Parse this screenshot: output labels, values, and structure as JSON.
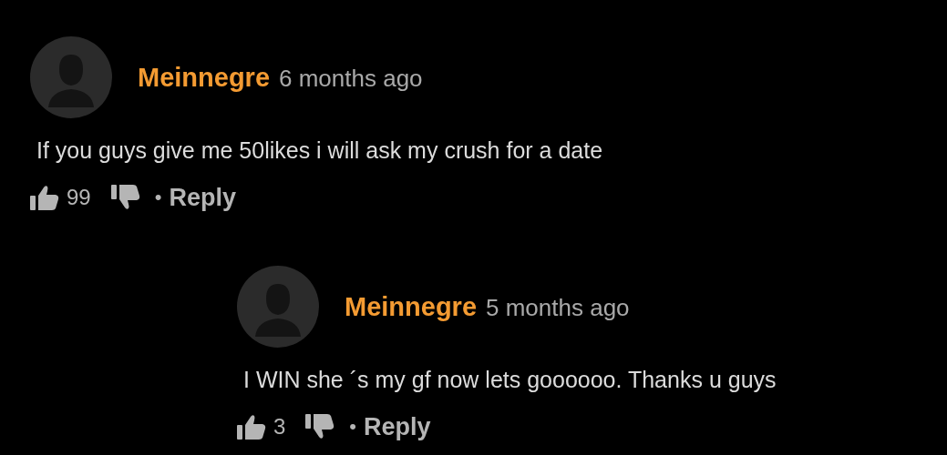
{
  "comments": [
    {
      "author": "Meinnegre",
      "time": "6 months ago",
      "text": "If you guys give me 50likes i will ask my crush for a date",
      "likes": "99",
      "separator": "•",
      "reply_label": "Reply",
      "replies": [
        {
          "author": "Meinnegre",
          "time": "5 months ago",
          "text": "I WIN she ´s my gf now lets goooooo. Thanks u guys",
          "likes": "3",
          "separator": "•",
          "reply_label": "Reply"
        }
      ]
    }
  ]
}
